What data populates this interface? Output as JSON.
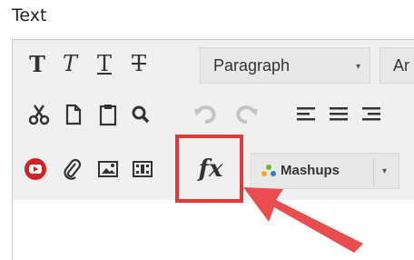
{
  "field_label": "Text",
  "toolbar": {
    "row1": {
      "buttons": [
        "bold-icon",
        "italic-icon",
        "underline-icon",
        "strikethrough-icon"
      ],
      "format_dropdown": "Paragraph",
      "font_dropdown_partial": "Ar"
    },
    "row2": {
      "buttons": [
        "cut-icon",
        "copy-icon",
        "paste-icon",
        "find-icon",
        "undo-icon",
        "redo-icon",
        "align-left-icon",
        "align-center-icon",
        "align-right-icon"
      ]
    },
    "row3": {
      "buttons": [
        "youtube-icon",
        "attachment-icon",
        "image-icon",
        "media-icon",
        "math-function-icon"
      ],
      "mashups_label": "Mashups",
      "math_label": "fx"
    }
  },
  "annotation": {
    "highlight_color": "#e03b3b"
  }
}
